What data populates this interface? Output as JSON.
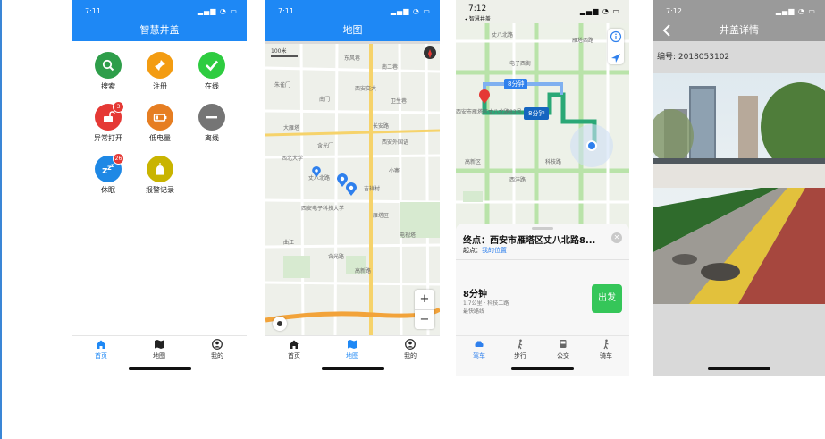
{
  "colors": {
    "blue": "#1e88f5",
    "green": "#4caf50",
    "map_bg": "#eef0ea"
  },
  "phone1": {
    "time": "7:11",
    "title": "智慧井盖",
    "grid": [
      {
        "label": "搜索",
        "color": "#2e9e4a",
        "icon": "search-icon",
        "badge": ""
      },
      {
        "label": "注册",
        "color": "#f39c12",
        "icon": "pin-icon",
        "badge": ""
      },
      {
        "label": "在线",
        "color": "#2ecc40",
        "icon": "check-icon",
        "badge": ""
      },
      {
        "label": "异常打开",
        "color": "#e53935",
        "icon": "unlock-icon",
        "badge": "3"
      },
      {
        "label": "低电量",
        "color": "#e67e22",
        "icon": "battery-icon",
        "badge": ""
      },
      {
        "label": "离线",
        "color": "#757575",
        "icon": "minus-icon",
        "badge": ""
      },
      {
        "label": "休眠",
        "color": "#1e88e5",
        "icon": "sleep-icon",
        "badge": "26"
      },
      {
        "label": "报警记录",
        "color": "#c9b400",
        "icon": "alarm-icon",
        "badge": ""
      }
    ],
    "tabs": [
      "首页",
      "地图",
      "我的"
    ]
  },
  "phone2": {
    "time": "7:11",
    "title": "地图",
    "scale": "100米",
    "map_labels": [
      "东风巷",
      "南二巷",
      "朱雀门",
      "西安交大",
      "南门",
      "卫生巷",
      "大雁塔",
      "长安路",
      "含光门",
      "西安外国语",
      "西北大学",
      "小寨",
      "丈八北路",
      "吉祥村",
      "西安电子科技大学",
      "雁塔区",
      "电视塔",
      "曲江",
      "含光路",
      "高新路"
    ],
    "zoom_in": "+",
    "zoom_out": "−",
    "tabs": [
      "首页",
      "地图",
      "我的"
    ]
  },
  "phone3": {
    "time": "7:12",
    "back_app": "◂ 智慧井盖",
    "route_tag1": "8分钟",
    "route_tag2": "8分钟",
    "map_labels": [
      "丈八北路",
      "西安市雁塔区丈八北路83号",
      "电子西街",
      "科技路",
      "西沣路",
      "雁塔西路",
      "高新区"
    ],
    "dest_title": "终点：西安市雁塔区丈八北路8...",
    "origin_label": "起点：",
    "origin_value": "我的位置",
    "duration": "8分钟",
    "distance": "1.7公里 · 科技二路",
    "route_type": "最快路线",
    "go_button": "出发",
    "modes": [
      "驾车",
      "步行",
      "公交",
      "骑车"
    ]
  },
  "phone4": {
    "time": "7:12",
    "title": "井盖详情",
    "id_label": "编号: 2018053102"
  }
}
